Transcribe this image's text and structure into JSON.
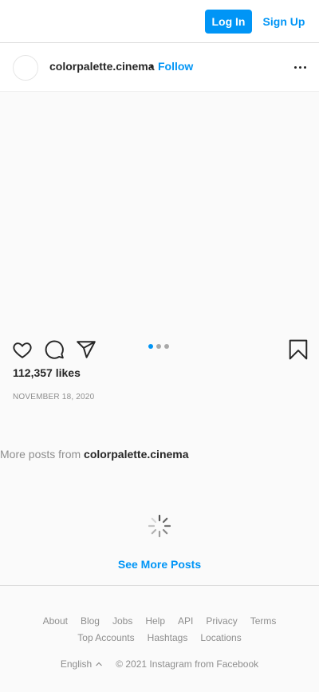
{
  "header": {
    "login_label": "Log In",
    "signup_label": "Sign Up"
  },
  "post": {
    "username": "colorpalette.cinema",
    "separator": "•",
    "follow_label": "Follow",
    "more_icon": "more-horizontal-icon",
    "likes_text": "112,357 likes",
    "date": "NOVEMBER 18, 2020",
    "carousel": {
      "count": 3,
      "active_index": 0
    },
    "actions": [
      "heart-icon",
      "comment-icon",
      "share-icon",
      "bookmark-icon"
    ]
  },
  "more_posts": {
    "prefix": "More posts from",
    "username": "colorpalette.cinema",
    "see_more_label": "See More Posts"
  },
  "footer": {
    "links_row1": [
      "About",
      "Blog",
      "Jobs",
      "Help",
      "API",
      "Privacy",
      "Terms"
    ],
    "links_row2": [
      "Top Accounts",
      "Hashtags",
      "Locations"
    ],
    "language": "English",
    "copyright": "© 2021 Instagram from Facebook"
  },
  "colors": {
    "accent": "#0095f6",
    "text": "#262626",
    "muted": "#8e8e8e",
    "background": "#fafafa",
    "border": "#dbdbdb"
  }
}
